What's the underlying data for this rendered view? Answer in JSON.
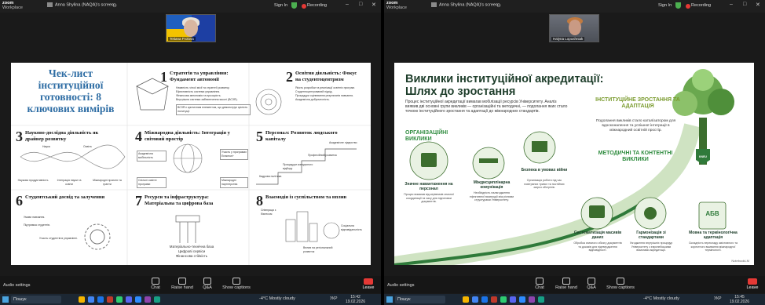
{
  "app": {
    "logo": "zoom",
    "logo_sub": "Workplace"
  },
  "left": {
    "tab_title": "Anna Shylina (NAQA)'s screen",
    "sign_in": "Sign In",
    "recording": "Recording",
    "participant_name": "Tetiana Frolova",
    "slide": {
      "title": "Чек-лист інституційної готовності: 8 ключових вимірів",
      "cards": [
        {
          "num": "1",
          "head": "Стратегія та управління: Фундамент автономії",
          "items": [
            "Наявність чіткої місії та стратегії розвитку.",
            "Ефективність системи управління.",
            "Фінансова автономія та прозорість.",
            "Внутрішня система забезпечення якості (ВСЗЯ).",
            "ВСЗЯ є критичним елементом, що демонструє зрілість інституції."
          ]
        },
        {
          "num": "2",
          "head": "Освітня діяльність: Фокус на студентоцентризм",
          "items": [
            "Якість розробки та реалізації освітніх програм.",
            "Студентоцентрований підхід.",
            "Процедури оцінювання результатів навчання.",
            "Академічна доброчесність."
          ]
        },
        {
          "num": "3",
          "head": "Науково-дослідна діяльність як драйвер розвитку",
          "items": [
            "Наука",
            "Освіта",
            "Наукова продуктивність",
            "Інтеграція науки та освіти",
            "Міжнародні проєкти та гранти"
          ]
        },
        {
          "num": "4",
          "head": "Міжнародна діяльність: Інтеграція у світовий простір",
          "items": [
            "Академічна мобільність",
            "Участь у програмах Erasmus+",
            "Спільні освітні програми",
            "Міжнародні партнерства"
          ]
        },
        {
          "num": "5",
          "head": "Персонал: Розвиток людського капіталу",
          "items": [
            "Академічне лідерство",
            "Професійний розвиток",
            "Процедури конкурсного відбору",
            "Кадрова політика"
          ]
        },
        {
          "num": "6",
          "head": "Студентський досвід та залучення",
          "items": [
            "Умови навчання.",
            "Підтримка студентів.",
            "Участь студентів в управлінні."
          ]
        },
        {
          "num": "7",
          "head": "Ресурси та інфраструктура: Матеріальна та цифрова база",
          "items": [
            "Матеріально-технічна база",
            "Цифрові сервіси",
            "Фінансова стійкість"
          ]
        },
        {
          "num": "8",
          "head": "Взаємодія із суспільством та вплив",
          "items": [
            "Співпраця з бізнесом",
            "Соціальна відповідальність",
            "Вплив на регіональний розвиток"
          ]
        }
      ]
    },
    "taskbar": {
      "search": "Пошук",
      "weather": "-4°C  Mostly cloudy",
      "lang": "УКР",
      "time": "15:42",
      "date": "19.02.2026"
    }
  },
  "right": {
    "tab_title": "Anna Shylina (NAQA)'s screen",
    "sign_in": "Sign In",
    "recording": "Recording",
    "participant_name": "Halyna Lopushniak",
    "slide": {
      "title": "Виклики інституційної акредитації: Шлях до зростання",
      "intro": "Процес інституційної акредитації вимагав мобілізації ресурсів Університету. Аналіз виявив дві основні групи викликів — організаційні та методичні, — подолання яких стало точкою інституційного зростання та адаптації до міжнародних стандартів.",
      "org_heading": "ОРГАНІЗАЦІЙНІ ВИКЛИКИ",
      "growth_heading": "ІНСТИТУЦІЙНЕ ЗРОСТАННЯ ТА АДАПТАЦІЯ",
      "growth_text": "Подолання викликів стало каталізатором для вдосконалення та успішної інтеграції в міжнародний освітній простір.",
      "method_heading": "МЕТОДИЧНІ ТА КОНТЕНТНІ ВИКЛИКИ",
      "items": [
        {
          "head": "Значне навантаження на персонал",
          "desc": "Процес вимагав від керівників значної координації та часу для підготовки документів."
        },
        {
          "head": "Міждисциплінарна комунікація",
          "desc": "Необхідність налагодження ефективної взаємодії між різними структурами Університету."
        },
        {
          "head": "Безпека в умовах війни",
          "desc": "Організація роботи під час повітряних тривог та постійних загроз обстрілів."
        },
        {
          "head": "Систематизація масивів даних",
          "desc": "Обробка значного обсягу документів та доказів для підтвердження відповідності."
        },
        {
          "head": "Гармонізація зі стандартами",
          "desc": "Узгодження внутрішніх процедур Університету з європейськими вимогами акредитації."
        },
        {
          "head": "Мовна та термінологічна адаптація",
          "desc": "Складність перекладу змістовного та коректного вживання міжнародної термінології."
        }
      ],
      "badge": "KNEU",
      "letters": "АБВ",
      "note": "NotebookLM"
    },
    "taskbar": {
      "search": "Пошук",
      "weather": "-4°C  Mostly cloudy",
      "lang": "УКР",
      "time": "15:45",
      "date": "19.02.2026"
    }
  },
  "toolbar": {
    "audio": "Audio settings",
    "chat": "Chat",
    "raise_hand": "Raise hand",
    "qa": "Q&A",
    "captions": "Show captions",
    "leave": "Leave"
  },
  "colors": {
    "accent_blue": "#2e6da4",
    "green": "#2e8b3e",
    "record": "#e53935"
  }
}
